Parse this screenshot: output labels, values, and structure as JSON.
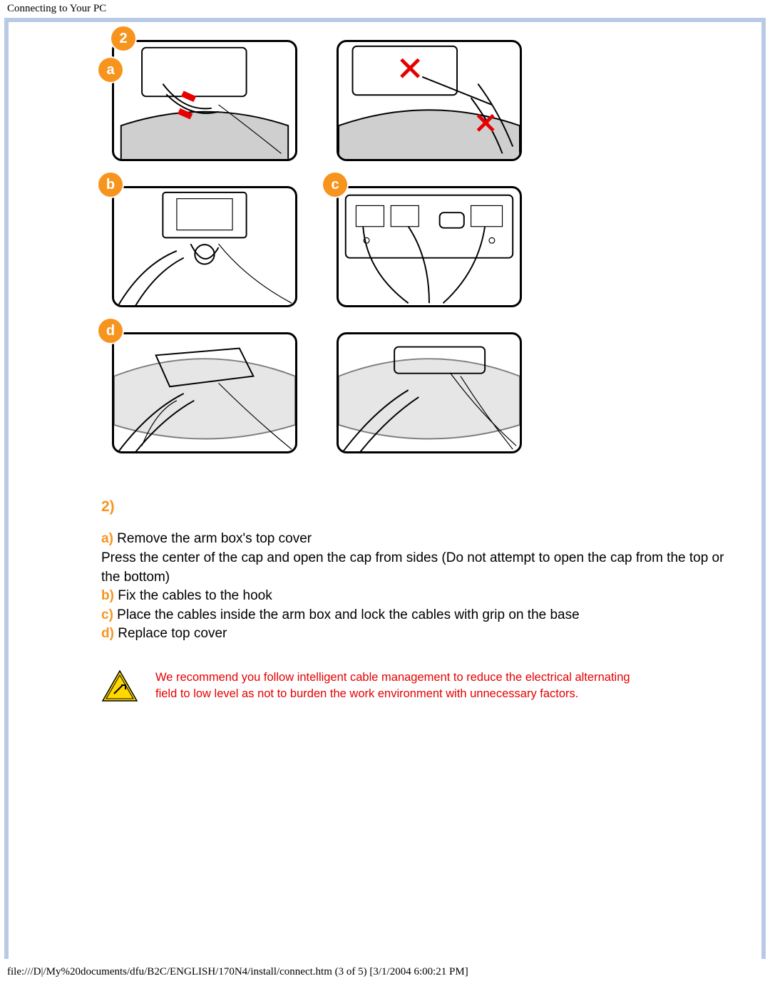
{
  "header": {
    "title": "Connecting to Your PC"
  },
  "badges": {
    "step2": "2",
    "a": "a",
    "b": "b",
    "c": "c",
    "d": "d"
  },
  "steps": {
    "number": "2)",
    "a_label": "a)",
    "a_text": " Remove the arm box's top cover",
    "a_sub": "Press the center of the cap and open the cap from sides (Do not attempt to open the cap from the top or the bottom)",
    "b_label": "b)",
    "b_text": " Fix the cables to the hook",
    "c_label": "c)",
    "c_text": " Place the cables inside the arm box and lock the cables with grip on the base",
    "d_label": "d)",
    "d_text": " Replace top cover"
  },
  "note": {
    "text": "We recommend you follow intelligent cable management to reduce the electrical alternating field to low level as not to burden the work environment with unnecessary factors."
  },
  "footer": {
    "text": "file:///D|/My%20documents/dfu/B2C/ENGLISH/170N4/install/connect.htm (3 of 5) [3/1/2004 6:00:21 PM]"
  }
}
